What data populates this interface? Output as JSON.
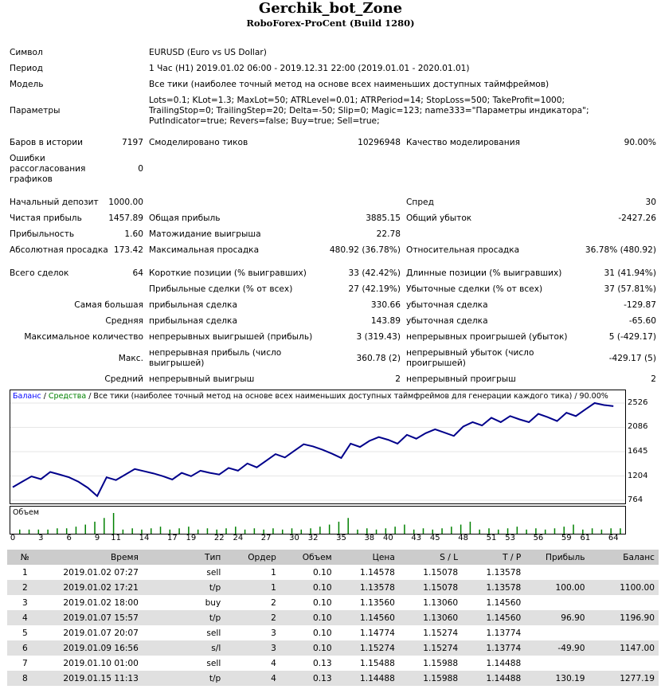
{
  "header": {
    "title": "Gerchik_bot_Zone",
    "subtitle": "RoboForex-ProCent (Build 1280)"
  },
  "info": {
    "symbol_label": "Символ",
    "symbol_value": "EURUSD (Euro vs US Dollar)",
    "period_label": "Период",
    "period_value": "1 Час (H1) 2019.01.02 06:00 - 2019.12.31 22:00 (2019.01.01 - 2020.01.01)",
    "model_label": "Модель",
    "model_value": "Все тики (наиболее точный метод на основе всех наименьших доступных таймфреймов)",
    "params_label": "Параметры",
    "params_value": "Lots=0.1; KLot=1.3; MaxLot=50; ATRLevel=0.01; ATRPeriod=14; StopLoss=500; TakeProfit=1000; TrailingStop=0; TrailingStep=20; Delta=-50; Slip=0; Magic=123; name333=\"Параметры индикатора\"; PutIndicator=true; Revers=false; Buy=true; Sell=true;"
  },
  "stats": {
    "bars_label": "Баров в истории",
    "bars_value": "7197",
    "ticks_label": "Смоделировано тиков",
    "ticks_value": "10296948",
    "quality_label": "Качество моделирования",
    "quality_value": "90.00%",
    "errors_label": "Ошибки рассогласования графиков",
    "errors_value": "0",
    "deposit_label": "Начальный депозит",
    "deposit_value": "1000.00",
    "spread_label": "Спред",
    "spread_value": "30",
    "net_label": "Чистая прибыль",
    "net_value": "1457.89",
    "gross_profit_label": "Общая прибыль",
    "gross_profit_value": "3885.15",
    "gross_loss_label": "Общий убыток",
    "gross_loss_value": "-2427.26",
    "pf_label": "Прибыльность",
    "pf_value": "1.60",
    "exp_label": "Матожидание выигрыша",
    "exp_value": "22.78",
    "abs_dd_label": "Абсолютная просадка",
    "abs_dd_value": "173.42",
    "max_dd_label": "Максимальная просадка",
    "max_dd_value": "480.92 (36.78%)",
    "rel_dd_label": "Относительная просадка",
    "rel_dd_value": "36.78% (480.92)",
    "total_label": "Всего сделок",
    "total_value": "64",
    "short_label": "Короткие позиции (% выигравших)",
    "short_value": "33 (42.42%)",
    "long_label": "Длинные позиции (% выигравших)",
    "long_value": "31 (41.94%)",
    "profit_trades_label": "Прибыльные сделки (% от всех)",
    "profit_trades_value": "27 (42.19%)",
    "loss_trades_label": "Убыточные сделки (% от всех)",
    "loss_trades_value": "37 (57.81%)",
    "largest_label": "Самая большая",
    "largest_profit_label": "прибыльная сделка",
    "largest_profit_value": "330.66",
    "largest_loss_label": "убыточная сделка",
    "largest_loss_value": "-129.87",
    "average_label": "Средняя",
    "average_profit_label": "прибыльная сделка",
    "average_profit_value": "143.89",
    "average_loss_label": "убыточная сделка",
    "average_loss_value": "-65.60",
    "maxcount_label": "Максимальное количество",
    "maxcount_wins_label": "непрерывных выигрышей (прибыль)",
    "maxcount_wins_value": "3 (319.43)",
    "maxcount_losses_label": "непрерывных проигрышей (убыток)",
    "maxcount_losses_value": "5 (-429.17)",
    "max_label": "Макс.",
    "max_profit_label": "непрерывная прибыль (число выигрышей)",
    "max_profit_value": "360.78 (2)",
    "max_loss_label": "непрерывный убыток (число проигрышей)",
    "max_loss_value": "-429.17 (5)",
    "avgcons_label": "Средний",
    "avgcons_wins_label": "непрерывный выигрыш",
    "avgcons_wins_value": "2",
    "avgcons_losses_label": "непрерывный проигрыш",
    "avgcons_losses_value": "2"
  },
  "chart_data": {
    "type": "line",
    "legend": {
      "balance": "Баланс",
      "slash1": " / ",
      "equity": "Средства",
      "rest": " / Все тики (наиболее точный метод на основе всех наименьших доступных таймфреймов для генерации каждого тика) / 90.00%"
    },
    "colors": {
      "balance": "#0000ff",
      "equity": "#008000",
      "line": "#00008b",
      "volume": "#008000"
    },
    "ylim": [
      764,
      2526
    ],
    "yticks": [
      "2526",
      "2086",
      "1645",
      "1204",
      "764"
    ],
    "xlim": [
      0,
      65
    ],
    "xticks": [
      "0",
      "3",
      "6",
      "9",
      "11",
      "14",
      "17",
      "19",
      "22",
      "24",
      "27",
      "30",
      "32",
      "35",
      "38",
      "40",
      "43",
      "45",
      "48",
      "51",
      "53",
      "56",
      "59",
      "61",
      "64"
    ],
    "volume_label": "Объем",
    "x": [
      0,
      1,
      2,
      3,
      4,
      5,
      6,
      7,
      8,
      9,
      10,
      11,
      12,
      13,
      14,
      15,
      16,
      17,
      18,
      19,
      20,
      21,
      22,
      23,
      24,
      25,
      26,
      27,
      28,
      29,
      30,
      31,
      32,
      33,
      34,
      35,
      36,
      37,
      38,
      39,
      40,
      41,
      42,
      43,
      44,
      45,
      46,
      47,
      48,
      49,
      50,
      51,
      52,
      53,
      54,
      55,
      56,
      57,
      58,
      59,
      60,
      61,
      62,
      63,
      64
    ],
    "balance": [
      1000,
      1100,
      1197,
      1147,
      1277,
      1230,
      1180,
      1100,
      990,
      840,
      1180,
      1130,
      1230,
      1330,
      1290,
      1250,
      1200,
      1140,
      1260,
      1200,
      1300,
      1260,
      1230,
      1350,
      1300,
      1430,
      1360,
      1480,
      1600,
      1540,
      1660,
      1780,
      1740,
      1680,
      1610,
      1530,
      1790,
      1730,
      1840,
      1910,
      1860,
      1790,
      1950,
      1880,
      1980,
      2050,
      1990,
      1930,
      2100,
      2180,
      2120,
      2260,
      2180,
      2290,
      2230,
      2180,
      2330,
      2270,
      2200,
      2350,
      2290,
      2410,
      2526,
      2490,
      2470
    ],
    "volume": [
      0.1,
      0.1,
      0.1,
      0.1,
      0.13,
      0.13,
      0.17,
      0.22,
      0.29,
      0.38,
      0.5,
      0.1,
      0.13,
      0.1,
      0.13,
      0.17,
      0.1,
      0.13,
      0.17,
      0.1,
      0.13,
      0.1,
      0.13,
      0.17,
      0.1,
      0.13,
      0.1,
      0.13,
      0.1,
      0.13,
      0.1,
      0.13,
      0.17,
      0.22,
      0.29,
      0.38,
      0.1,
      0.13,
      0.1,
      0.13,
      0.17,
      0.22,
      0.1,
      0.13,
      0.1,
      0.13,
      0.17,
      0.22,
      0.29,
      0.1,
      0.13,
      0.1,
      0.13,
      0.17,
      0.1,
      0.13,
      0.1,
      0.13,
      0.17,
      0.22,
      0.1,
      0.13,
      0.1,
      0.13,
      0.13
    ]
  },
  "deals": {
    "headers": [
      "№",
      "Время",
      "Тип",
      "Ордер",
      "Объем",
      "Цена",
      "S / L",
      "T / P",
      "Прибыль",
      "Баланс"
    ],
    "rows": [
      [
        "1",
        "2019.01.02 07:27",
        "sell",
        "1",
        "0.10",
        "1.14578",
        "1.15078",
        "1.13578",
        "",
        ""
      ],
      [
        "2",
        "2019.01.02 17:21",
        "t/p",
        "1",
        "0.10",
        "1.13578",
        "1.15078",
        "1.13578",
        "100.00",
        "1100.00"
      ],
      [
        "3",
        "2019.01.02 18:00",
        "buy",
        "2",
        "0.10",
        "1.13560",
        "1.13060",
        "1.14560",
        "",
        ""
      ],
      [
        "4",
        "2019.01.07 15:57",
        "t/p",
        "2",
        "0.10",
        "1.14560",
        "1.13060",
        "1.14560",
        "96.90",
        "1196.90"
      ],
      [
        "5",
        "2019.01.07 20:07",
        "sell",
        "3",
        "0.10",
        "1.14774",
        "1.15274",
        "1.13774",
        "",
        ""
      ],
      [
        "6",
        "2019.01.09 16:56",
        "s/l",
        "3",
        "0.10",
        "1.15274",
        "1.15274",
        "1.13774",
        "-49.90",
        "1147.00"
      ],
      [
        "7",
        "2019.01.10 01:00",
        "sell",
        "4",
        "0.13",
        "1.15488",
        "1.15988",
        "1.14488",
        "",
        ""
      ],
      [
        "8",
        "2019.01.15 11:13",
        "t/p",
        "4",
        "0.13",
        "1.14488",
        "1.15988",
        "1.14488",
        "130.19",
        "1277.19"
      ]
    ]
  }
}
